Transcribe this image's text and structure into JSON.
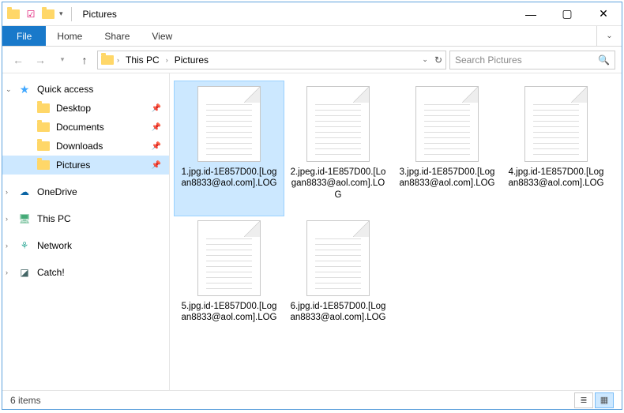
{
  "title": "Pictures",
  "titlebar": {
    "app_icon": "folder-icon"
  },
  "ribbon": {
    "file": "File",
    "tabs": [
      "Home",
      "Share",
      "View"
    ]
  },
  "nav_buttons": {
    "back": "←",
    "forward": "→",
    "up": "↑"
  },
  "address": {
    "root_icon": "folder",
    "crumbs": [
      "This PC",
      "Pictures"
    ]
  },
  "search": {
    "placeholder": "Search Pictures"
  },
  "tree": {
    "quick_access": "Quick access",
    "quick_items": [
      {
        "label": "Desktop",
        "pinned": true
      },
      {
        "label": "Documents",
        "pinned": true
      },
      {
        "label": "Downloads",
        "pinned": true
      },
      {
        "label": "Pictures",
        "pinned": true,
        "selected": true
      }
    ],
    "roots": [
      {
        "label": "OneDrive",
        "icon": "onedrive"
      },
      {
        "label": "This PC",
        "icon": "pc"
      },
      {
        "label": "Network",
        "icon": "network"
      },
      {
        "label": "Catch!",
        "icon": "catch"
      }
    ]
  },
  "files": [
    {
      "name": "1.jpg.id-1E857D00.[Logan8833@aol.com].LOG",
      "selected": true
    },
    {
      "name": "2.jpeg.id-1E857D00.[Logan8833@aol.com].LOG"
    },
    {
      "name": "3.jpg.id-1E857D00.[Logan8833@aol.com].LOG"
    },
    {
      "name": "4.jpg.id-1E857D00.[Logan8833@aol.com].LOG"
    },
    {
      "name": "5.jpg.id-1E857D00.[Logan8833@aol.com].LOG"
    },
    {
      "name": "6.jpg.id-1E857D00.[Logan8833@aol.com].LOG"
    }
  ],
  "status": {
    "count": "6 items"
  },
  "view": {
    "details": "≣",
    "icons": "▦"
  }
}
